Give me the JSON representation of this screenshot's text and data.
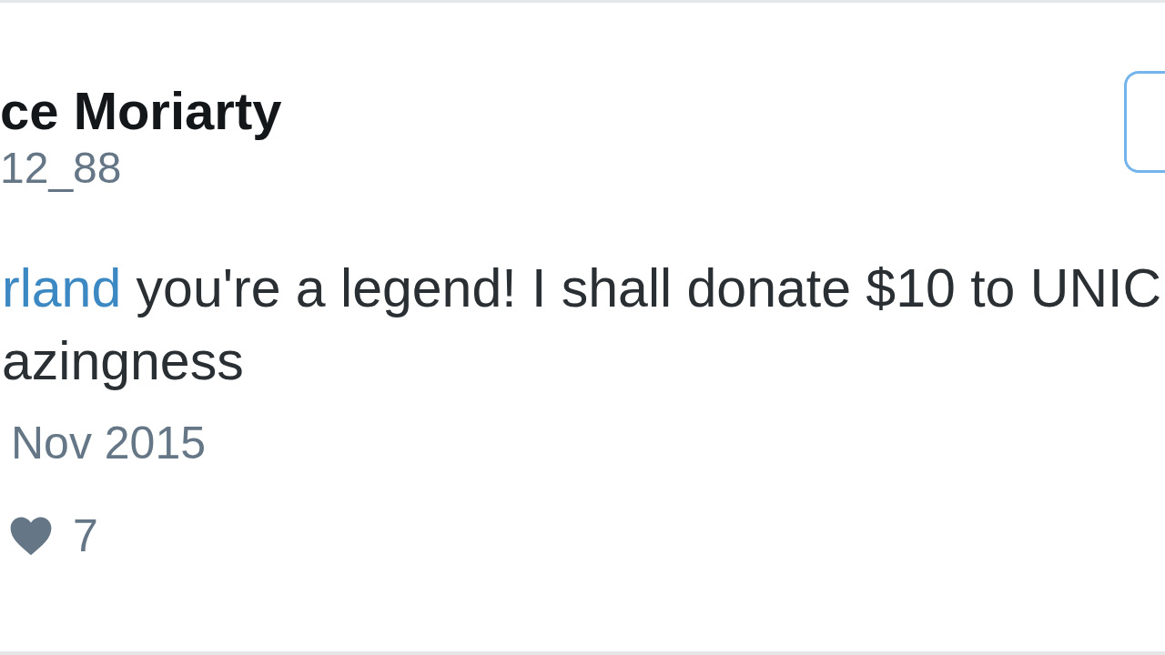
{
  "header": {
    "name": "ce Moriarty",
    "handle": "12_88",
    "button": {
      "kind": "outlined"
    }
  },
  "tweet": {
    "lines": [
      {
        "segments": [
          {
            "kind": "mention",
            "text": "rland"
          },
          {
            "kind": "plain",
            "text": " you're a legend! I shall donate $10 to UNIC"
          }
        ]
      },
      {
        "segments": [
          {
            "kind": "plain",
            "text": "azingness"
          }
        ]
      }
    ],
    "date": "Nov 2015",
    "likes": {
      "count": "7",
      "liked": false
    }
  }
}
